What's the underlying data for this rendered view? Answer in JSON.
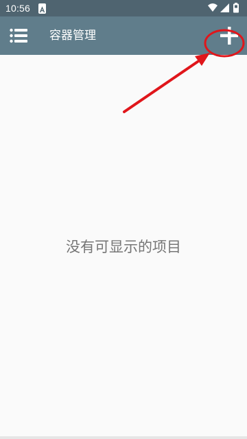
{
  "status_bar": {
    "time": "10:56",
    "icons": [
      "notification-a-icon",
      "wifi-icon",
      "signal-icon",
      "battery-icon"
    ]
  },
  "app_bar": {
    "title": "容器管理",
    "menu_icon": "list-menu-icon",
    "add_icon": "plus-icon"
  },
  "main": {
    "empty_message": "没有可显示的项目"
  },
  "annotation": {
    "color": "#e0161b",
    "target": "add-button"
  },
  "colors": {
    "status_bar": "#4f6470",
    "app_bar": "#607d8b",
    "background": "#fafafa",
    "empty_text": "#757575"
  }
}
